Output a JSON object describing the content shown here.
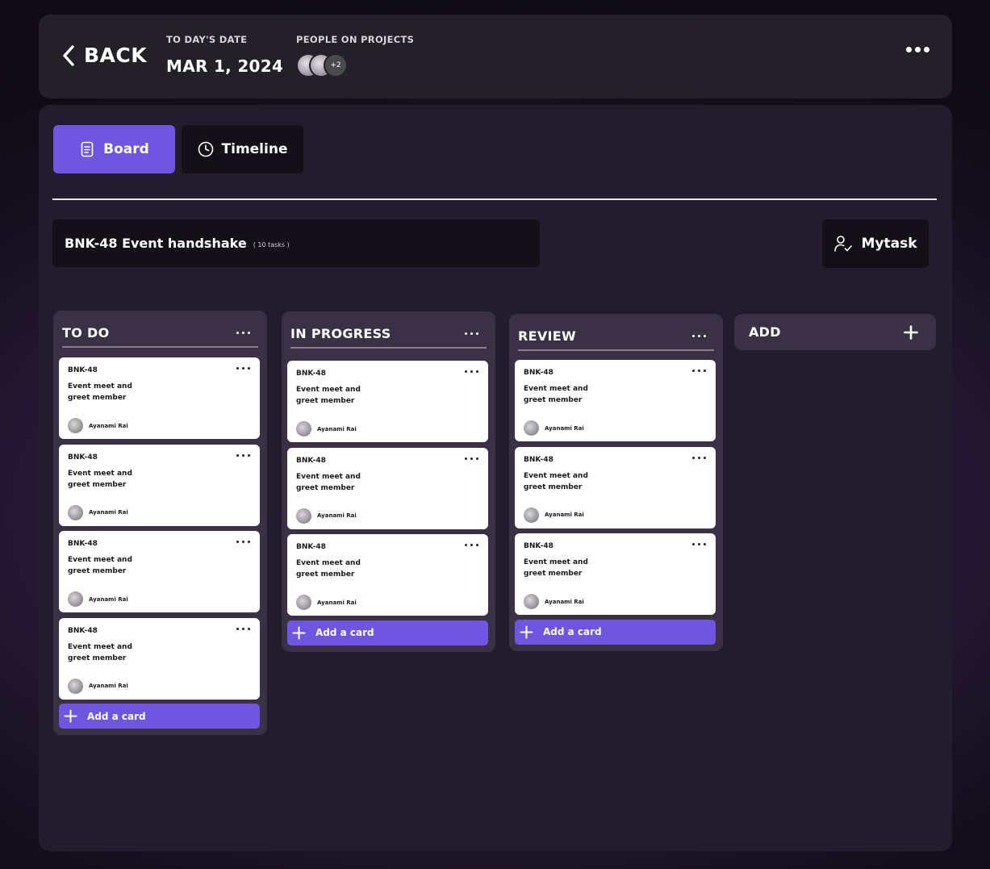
{
  "header": {
    "back_label": "BACK",
    "date_caption": "TO DAY'S DATE",
    "date_value": "MAR 1, 2024",
    "people_caption": "PEOPLE ON PROJECTS",
    "people_more": "+2"
  },
  "tabs": [
    {
      "label": "Board",
      "icon": "document-icon",
      "active": true
    },
    {
      "label": "Timeline",
      "icon": "clock-icon",
      "active": false
    }
  ],
  "project": {
    "title": "BNK-48 Event handshake",
    "count": "( 10 tasks )"
  },
  "mytask_label": "Mytask",
  "columns": [
    {
      "title": "TO DO",
      "cards": [
        {
          "id": "BNK-48",
          "title": "Event meet and greet member",
          "assignee": "Ayanami Rai"
        },
        {
          "id": "BNK-48",
          "title": "Event meet and greet member",
          "assignee": "Ayanami Rai"
        },
        {
          "id": "BNK-48",
          "title": "Event meet and greet member",
          "assignee": "Ayanami Rai"
        },
        {
          "id": "BNK-48",
          "title": "Event meet and greet member",
          "assignee": "Ayanami Rai"
        }
      ],
      "add_label": "Add a card"
    },
    {
      "title": "IN PROGRESS",
      "cards": [
        {
          "id": "BNK-48",
          "title": "Event meet and greet member",
          "assignee": "Ayanami Rai"
        },
        {
          "id": "BNK-48",
          "title": "Event meet and greet member",
          "assignee": "Ayanami Rai"
        },
        {
          "id": "BNK-48",
          "title": "Event meet and greet member",
          "assignee": "Ayanami Rai"
        }
      ],
      "add_label": "Add a card"
    },
    {
      "title": "REVIEW",
      "cards": [
        {
          "id": "BNK-48",
          "title": "Event meet and greet member",
          "assignee": "Ayanami Rai"
        },
        {
          "id": "BNK-48",
          "title": "Event meet and greet member",
          "assignee": "Ayanami Rai"
        },
        {
          "id": "BNK-48",
          "title": "Event meet and greet member",
          "assignee": "Ayanami Rai"
        }
      ],
      "add_label": "Add a card"
    }
  ],
  "add_column_label": "ADD",
  "colors": {
    "accent": "#6f56e0",
    "panel": "#231c2c",
    "column": "#3b3147",
    "card": "#ffffff"
  }
}
